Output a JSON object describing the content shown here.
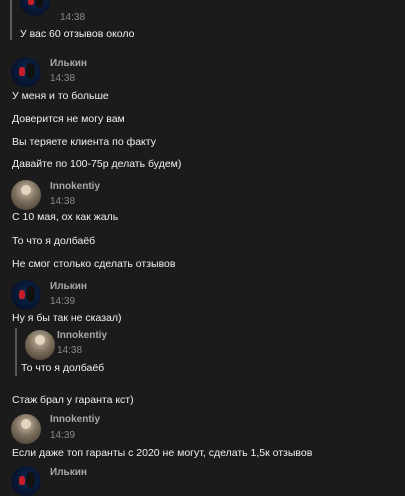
{
  "messages": {
    "q1_time": "14:38",
    "q1_text": "У вас 60 отзывов около",
    "m1_name": "Илькин",
    "m1_time": "14:38",
    "m1_l1": "У меня и то больше",
    "m1_l2": "Доверится не могу вам",
    "m1_l3": "Вы теряете клиента по факту",
    "m1_l4": "Давайте по 100-75р делать будем)",
    "m2_name": "Innokentiy",
    "m2_time": "14:38",
    "m2_l1": "С 10 мая, ох как жаль",
    "m2_l2": "То что я долбаёб",
    "m2_l3": "Не смог столько сделать отзывов",
    "m3_name": "Илькин",
    "m3_time": "14:39",
    "m3_l1": "Ну я бы так не сказал)",
    "q2_name": "Innokentiy",
    "q2_time": "14:38",
    "q2_text": "То что я долбаёб",
    "m3_l2": "Стаж брал у гаранта кст)",
    "m4_name": "Innokentiy",
    "m4_time": "14:39",
    "m4_l1": "Если даже топ гаранты с 2020 не могут, сделать 1,5к отзывов",
    "m5_name": "Илькин"
  }
}
